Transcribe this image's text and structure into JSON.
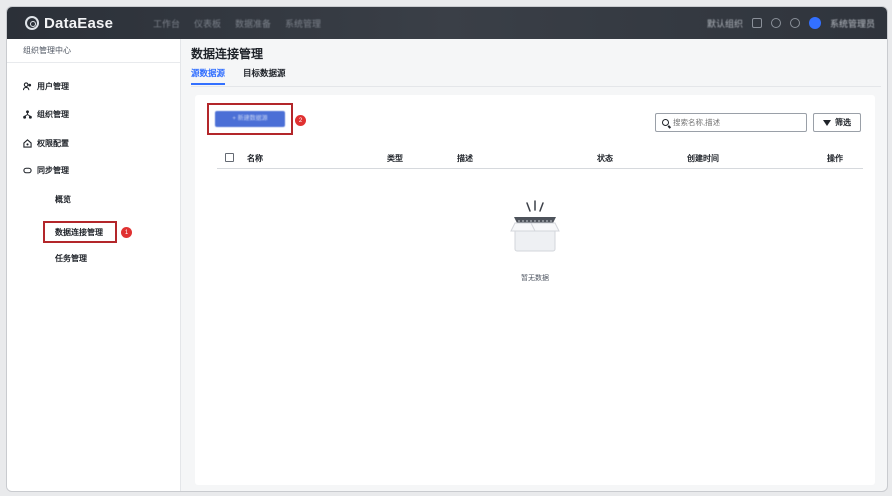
{
  "app": {
    "logo_text": "DataEase"
  },
  "topnav": {
    "items": [
      "工作台",
      "仪表板",
      "数据准备",
      "系统管理"
    ]
  },
  "topbar_right": {
    "org": "默认组织",
    "user": "系统管理员"
  },
  "sidebar": {
    "header": "组织管理中心",
    "items": [
      {
        "label": "用户管理",
        "icon": "users-icon"
      },
      {
        "label": "组织管理",
        "icon": "org-icon"
      },
      {
        "label": "权限配置",
        "icon": "lock-icon"
      },
      {
        "label": "同步管理",
        "icon": "sync-icon"
      }
    ],
    "sub_items": [
      "概览",
      "数据连接管理",
      "任务管理"
    ]
  },
  "annotations": {
    "badge1": "1",
    "badge2": "2"
  },
  "main": {
    "title": "数据连接管理",
    "tabs": [
      "源数据源",
      "目标数据源"
    ],
    "new_button": "+ 新建数据源",
    "search_placeholder": "搜索名称,描述",
    "filter_label": "筛选",
    "table": {
      "columns": [
        "名称",
        "类型",
        "描述",
        "状态",
        "创建时间",
        "操作"
      ]
    },
    "empty_text": "暂无数据"
  },
  "colors": {
    "accent": "#3370ff",
    "highlight_border": "#b3262a",
    "badge": "#e03131"
  }
}
